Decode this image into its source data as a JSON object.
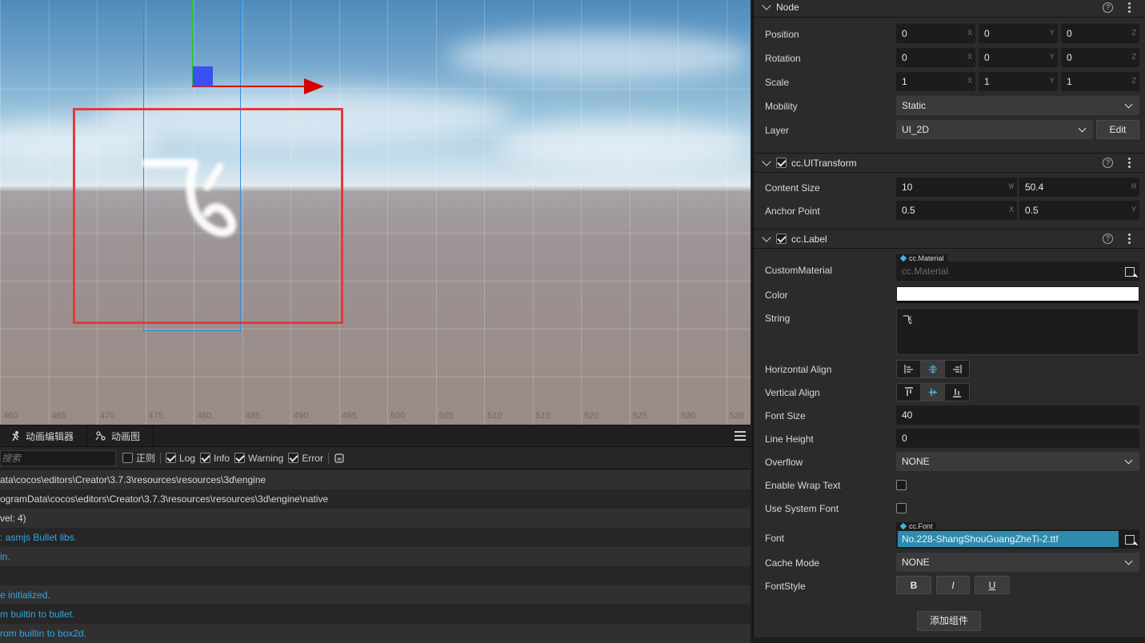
{
  "scene": {
    "ruler_ticks": [
      "460",
      "465",
      "470",
      "475",
      "480",
      "485",
      "490",
      "495",
      "500",
      "505",
      "510",
      "515",
      "520",
      "525",
      "530",
      "535"
    ],
    "label_glyph": "飞"
  },
  "console": {
    "tabs": [
      {
        "label": "动画编辑器",
        "icon": "animation-editor-icon"
      },
      {
        "label": "动画图",
        "icon": "animation-graph-icon"
      }
    ],
    "search_placeholder": "搜索",
    "filters": [
      {
        "label": "正则",
        "checked": false
      },
      {
        "label": "Log",
        "checked": true
      },
      {
        "label": "Info",
        "checked": true
      },
      {
        "label": "Warning",
        "checked": true
      },
      {
        "label": "Error",
        "checked": true
      }
    ],
    "logs": [
      {
        "text": "ata\\cocos\\editors\\Creator\\3.7.3\\resources\\resources\\3d\\engine",
        "type": "plain"
      },
      {
        "text": "ogramData\\cocos\\editors\\Creator\\3.7.3\\resources\\resources\\3d\\engine\\native",
        "type": "plain"
      },
      {
        "text": "vel: 4)",
        "type": "plain"
      },
      {
        "text": ": asmjs Bullet libs.",
        "type": "info"
      },
      {
        "text": "in.",
        "type": "info"
      },
      {
        "text": "",
        "type": "plain"
      },
      {
        "text": "e initialized.",
        "type": "info"
      },
      {
        "text": "m builtin to bullet.",
        "type": "info"
      },
      {
        "text": "rom builtin to box2d.",
        "type": "info"
      }
    ]
  },
  "inspector": {
    "node": {
      "title": "Node",
      "position": {
        "label": "Position",
        "x": "0",
        "y": "0",
        "z": "0"
      },
      "rotation": {
        "label": "Rotation",
        "x": "0",
        "y": "0",
        "z": "0"
      },
      "scale": {
        "label": "Scale",
        "x": "1",
        "y": "1",
        "z": "1"
      },
      "mobility": {
        "label": "Mobility",
        "value": "Static"
      },
      "layer": {
        "label": "Layer",
        "value": "UI_2D",
        "edit": "Edit"
      }
    },
    "ui_transform": {
      "title": "cc.UITransform",
      "content_size": {
        "label": "Content Size",
        "w": "10",
        "h": "50.4"
      },
      "anchor_point": {
        "label": "Anchor Point",
        "x": "0.5",
        "y": "0.5"
      }
    },
    "label": {
      "title": "cc.Label",
      "custom_material": {
        "label": "CustomMaterial",
        "tag": "cc.Material",
        "placeholder": "cc.Material"
      },
      "color": {
        "label": "Color",
        "value": "#ffffff"
      },
      "string": {
        "label": "String",
        "value": "飞"
      },
      "horizontal_align": {
        "label": "Horizontal Align",
        "selected": "center"
      },
      "vertical_align": {
        "label": "Vertical Align",
        "selected": "center"
      },
      "font_size": {
        "label": "Font Size",
        "value": "40"
      },
      "line_height": {
        "label": "Line Height",
        "value": "0"
      },
      "overflow": {
        "label": "Overflow",
        "value": "NONE"
      },
      "enable_wrap_text": {
        "label": "Enable Wrap Text",
        "checked": false
      },
      "use_system_font": {
        "label": "Use System Font",
        "checked": false
      },
      "font": {
        "label": "Font",
        "tag": "cc.Font",
        "value": "No.228-ShangShouGuangZheTi-2.ttf"
      },
      "cache_mode": {
        "label": "Cache Mode",
        "value": "NONE"
      },
      "font_style": {
        "label": "FontStyle",
        "bold": "B",
        "italic": "I",
        "underline": "U"
      }
    },
    "add_component": "添加组件"
  }
}
